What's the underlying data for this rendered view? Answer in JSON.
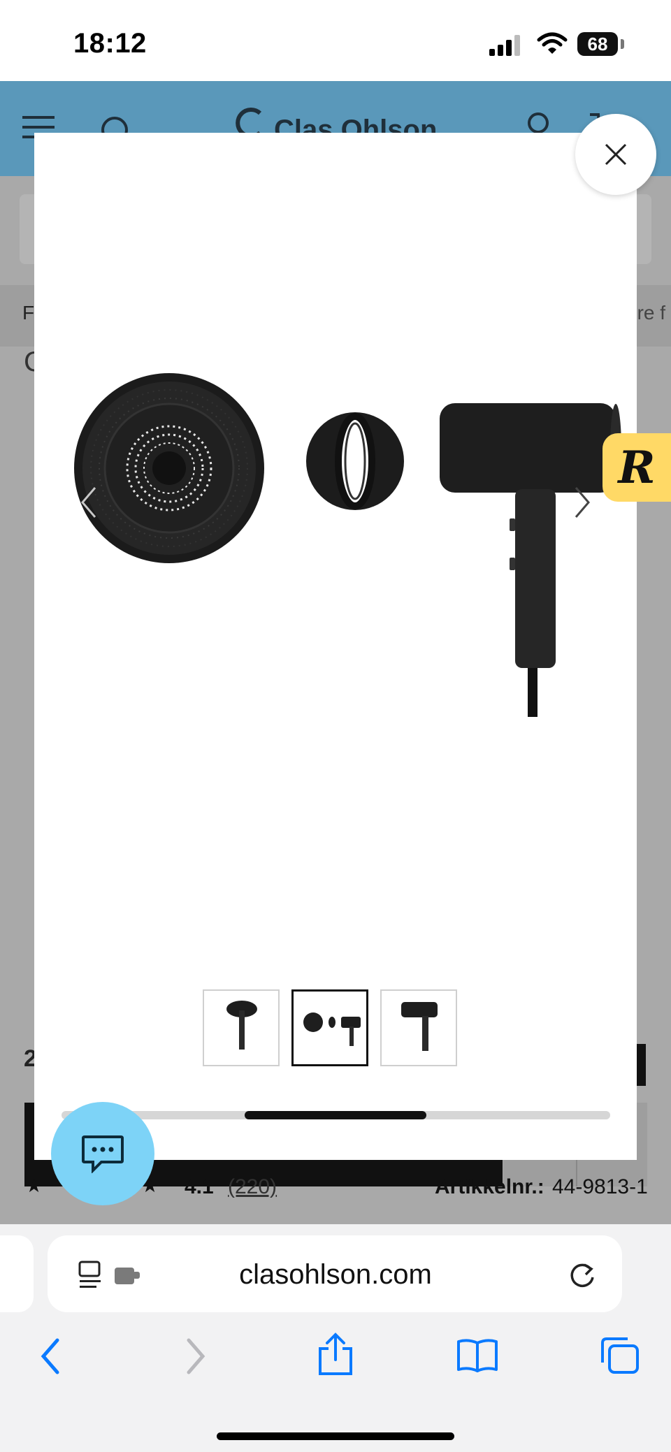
{
  "status_bar": {
    "time": "18:12",
    "battery": "68"
  },
  "site": {
    "brand": "Clas Ohlson",
    "bg_fragment_left": "F",
    "bg_fragment_right": "ere f",
    "bg_heading_initial": "C",
    "bg_price_fragment": "2",
    "bg_rating_count": "(220)",
    "bg_rating_value": "4.1",
    "bg_article_label": "Artikkelnr.:",
    "bg_article_number": "44-9813-1"
  },
  "gallery": {
    "thumbnails": [
      {
        "icon": "hair-dryer-thumbnail",
        "active": false
      },
      {
        "icon": "accessories-thumbnail",
        "active": true
      },
      {
        "icon": "hair-dryer-side-thumbnail",
        "active": false
      }
    ],
    "prev_icon": "chevron-left-icon",
    "next_icon": "chevron-right-icon",
    "close_icon": "close-icon",
    "scroll_progress": 0.45
  },
  "badge": {
    "letter": "R"
  },
  "browser": {
    "url": "clasohlson.com"
  },
  "colors": {
    "header_blue": "#5a98ba",
    "chat_blue": "#7dd3f7",
    "badge_yellow": "#ffd966",
    "safari_blue": "#0a7aff"
  }
}
